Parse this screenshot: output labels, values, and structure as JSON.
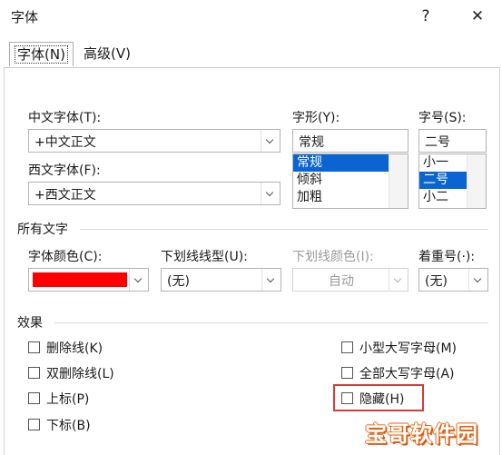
{
  "window": {
    "title": "字体",
    "help_glyph": "?",
    "close_glyph": "✕"
  },
  "tabs": [
    {
      "label": "字体(N)",
      "active": true
    },
    {
      "label": "高级(V)",
      "active": false
    }
  ],
  "font": {
    "chinese_label": "中文字体(T):",
    "chinese_value": "+中文正文",
    "western_label": "西文字体(F):",
    "western_value": "+西文正文",
    "style_label": "字形(Y):",
    "style_value": "常规",
    "style_options": [
      "常规",
      "倾斜",
      "加粗"
    ],
    "style_selected": "常规",
    "size_label": "字号(S):",
    "size_value": "二号",
    "size_options": [
      "小一",
      "二号",
      "小二"
    ],
    "size_selected": "二号"
  },
  "all_text": {
    "section_label": "所有文字",
    "color_label": "字体颜色(C):",
    "color_value": "#ff0000",
    "underline_style_label": "下划线线型(U):",
    "underline_style_value": "(无)",
    "underline_color_label": "下划线颜色(I):",
    "underline_color_value": "自动",
    "emphasis_label": "着重号(·):",
    "emphasis_value": "(无)"
  },
  "effects": {
    "section_label": "效果",
    "left": [
      {
        "label": "删除线(K)",
        "checked": false
      },
      {
        "label": "双删除线(L)",
        "checked": false
      },
      {
        "label": "上标(P)",
        "checked": false
      },
      {
        "label": "下标(B)",
        "checked": false
      }
    ],
    "right": [
      {
        "label": "小型大写字母(M)",
        "checked": false
      },
      {
        "label": "全部大写字母(A)",
        "checked": false
      },
      {
        "label": "隐藏(H)",
        "checked": false
      }
    ]
  },
  "watermark": {
    "text": "宝哥软件园"
  }
}
